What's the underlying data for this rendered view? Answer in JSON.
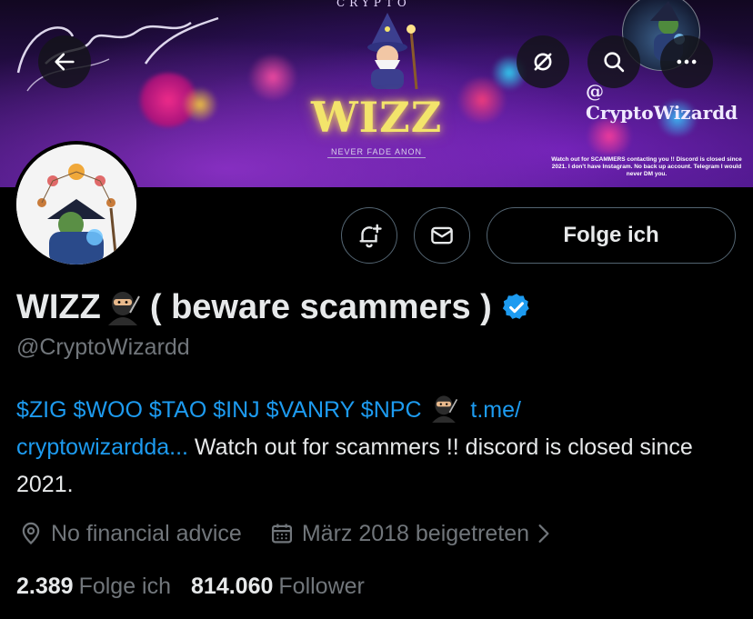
{
  "banner": {
    "top_text": "CRYPTO",
    "logo_text": "WIZZ",
    "tagline": "NEVER FADE ANON",
    "handle_text": "@ CryptoWizardd",
    "note": "Watch out for SCAMMERS contacting you !! Discord is closed since 2021. I don't have Instagram. No back up account. Telegram I would never DM you."
  },
  "nav": {
    "back_icon": "arrow-left-icon",
    "grok_icon": "slashed-circle-icon",
    "search_icon": "search-icon",
    "more_icon": "ellipsis-icon"
  },
  "profile": {
    "name_prefix": "WIZZ",
    "name_suffix": "( beware scammers )",
    "handle": "@CryptoWizardd",
    "verified_color": "#1d9bf0"
  },
  "actions": {
    "notify_icon": "bell-plus-icon",
    "message_icon": "envelope-icon",
    "follow_label": "Folge ich"
  },
  "bio": {
    "tickers": "$ZIG $WOO $TAO $INJ $VANRY $NPC",
    "link_part1": "t.me/",
    "link_part2": "cryptowizardda...",
    "text_after_link": " Watch out for scammers !! discord is closed since 2021."
  },
  "meta": {
    "location": "No financial advice",
    "joined": "März 2018 beigetreten"
  },
  "stats": {
    "following_count": "2.389",
    "following_label": "Folge ich",
    "followers_count": "814.060",
    "followers_label": "Follower"
  },
  "colors": {
    "background": "#000000",
    "accent": "#1d9bf0",
    "muted": "#71767b",
    "logo_yellow": "#f3e46b"
  }
}
